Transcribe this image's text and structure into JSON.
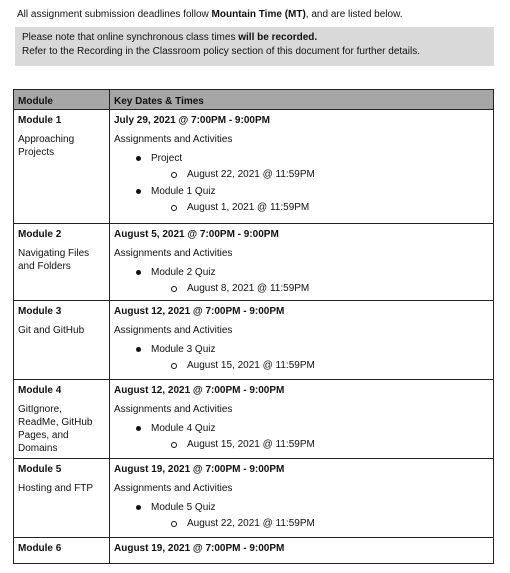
{
  "intro": {
    "prefix": "All assignment submission deadlines follow ",
    "bold": "Mountain Time (MT)",
    "suffix": ", and are listed below."
  },
  "note": {
    "line1_prefix": "Please note that online synchronous class times ",
    "line1_bold": "will be recorded.",
    "line2": "Refer to the Recording in the Classroom policy section of this document for further details."
  },
  "table": {
    "headers": [
      "Module",
      "Key Dates & Times"
    ],
    "rows": [
      {
        "module": "Module 1",
        "name": "Approaching Projects",
        "date": "July 29, 2021 @ 7:00PM - 9:00PM",
        "subtitle": "Assignments and Activities",
        "items": [
          {
            "label": "Project",
            "deadline": "August 22, 2021 @ 11:59PM"
          },
          {
            "label": "Module 1 Quiz",
            "deadline": "August 1, 2021 @ 11:59PM"
          }
        ]
      },
      {
        "module": "Module 2",
        "name": "Navigating Files and Folders",
        "date": "August 5, 2021 @ 7:00PM - 9:00PM",
        "subtitle": "Assignments and Activities",
        "items": [
          {
            "label": "Module 2 Quiz",
            "deadline": "August 8, 2021 @ 11:59PM"
          }
        ]
      },
      {
        "module": "Module 3",
        "name": "Git and GitHub",
        "date": "August 12, 2021 @ 7:00PM - 9:00PM",
        "subtitle": "Assignments and Activities",
        "items": [
          {
            "label": "Module 3 Quiz",
            "deadline": "August 15, 2021 @ 11:59PM"
          }
        ]
      },
      {
        "module": "Module 4",
        "name": "GitIgnore, ReadMe, GitHub Pages, and Domains",
        "date": "August 12, 2021 @ 7:00PM - 9:00PM",
        "subtitle": "Assignments and Activities",
        "items": [
          {
            "label": "Module 4 Quiz",
            "deadline": "August 15, 2021 @ 11:59PM"
          }
        ]
      },
      {
        "module": "Module 5",
        "name": "Hosting and FTP",
        "date": "August 19, 2021 @ 7:00PM - 9:00PM",
        "subtitle": "Assignments and Activities",
        "items": [
          {
            "label": "Module 5 Quiz",
            "deadline": "August 22, 2021 @ 11:59PM"
          }
        ]
      },
      {
        "module": "Module 6",
        "name": "",
        "date": "August 19, 2021 @ 7:00PM - 9:00PM",
        "subtitle": "",
        "items": []
      }
    ]
  }
}
